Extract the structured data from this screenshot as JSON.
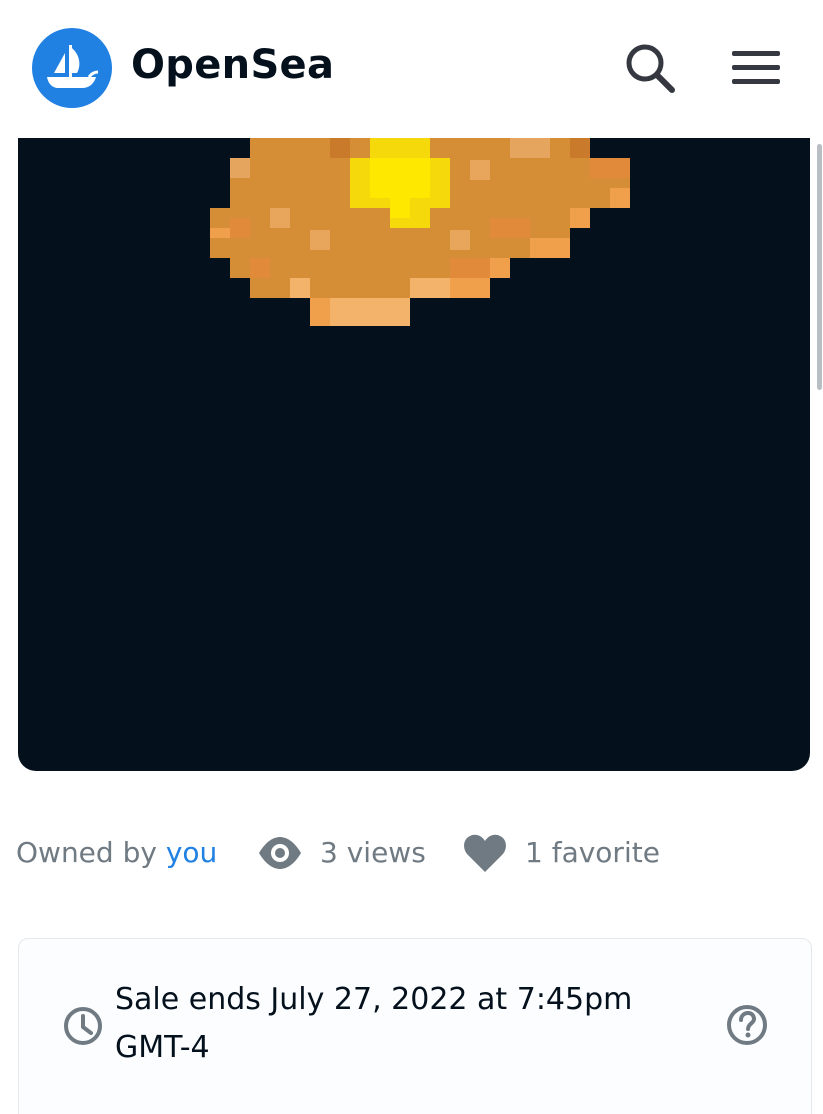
{
  "header": {
    "brand_name": "OpenSea",
    "logo_icon": "opensea-ship-logo",
    "search_icon": "search-icon",
    "menu_icon": "hamburger-menu-icon"
  },
  "colors": {
    "brand_blue": "#2081E2",
    "text_dark": "#04111D",
    "text_muted": "#707A83",
    "nft_background": "#04111D"
  },
  "nft": {
    "alt": "pixel-art gold nugget"
  },
  "stats": {
    "owned_prefix": "Owned by",
    "owner": "you",
    "views": "3 views",
    "favorites": "1 favorite",
    "views_icon": "eye-icon",
    "favorites_icon": "heart-icon"
  },
  "sale": {
    "ends_text": "Sale ends July 27, 2022 at 7:45pm GMT-4",
    "clock_icon": "clock-icon",
    "help_icon": "help-circle-icon"
  }
}
